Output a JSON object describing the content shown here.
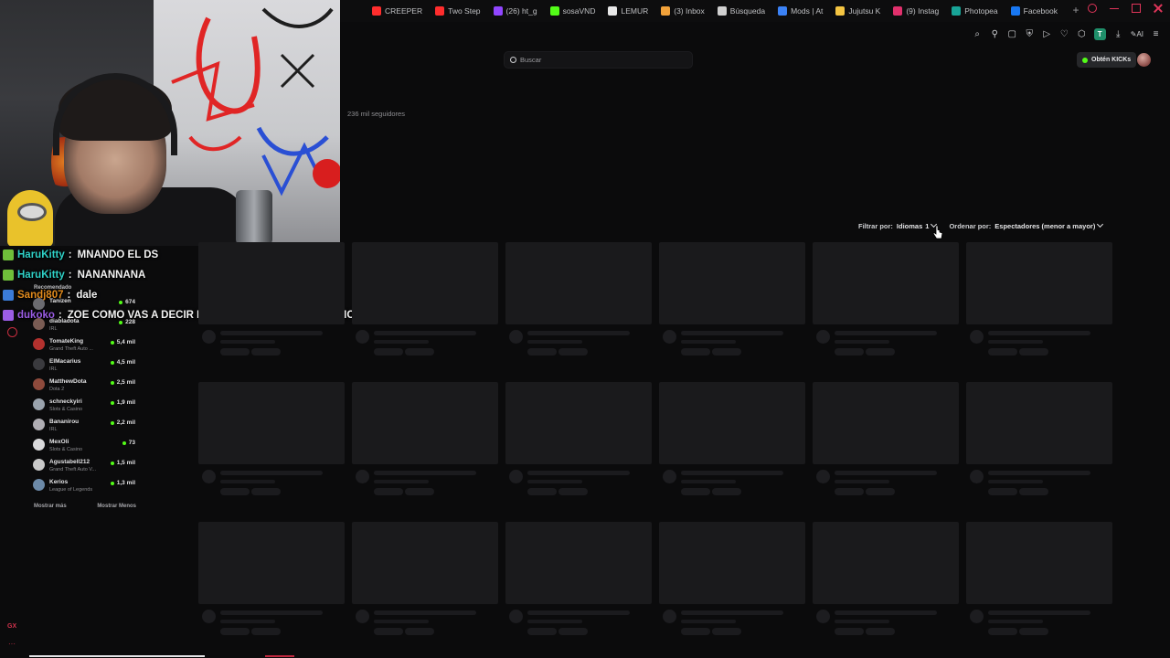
{
  "browser": {
    "tabs": [
      {
        "label": "CREEPER",
        "color": "#ff2d2d"
      },
      {
        "label": "Two Step",
        "color": "#ff2d2d"
      },
      {
        "label": "(26) ht_g",
        "color": "#9146ff"
      },
      {
        "label": "sosaVND",
        "color": "#53fc18"
      },
      {
        "label": "LEMUR",
        "color": "#e8e8e8"
      },
      {
        "label": "(3) Inbox",
        "color": "#f2a23a"
      },
      {
        "label": "Búsqueda",
        "color": "#d0d0d0"
      },
      {
        "label": "Mods | At",
        "color": "#3b82f6"
      },
      {
        "label": "Jujutsu K",
        "color": "#f5c542"
      },
      {
        "label": "(9) Instag",
        "color": "#e1306c"
      },
      {
        "label": "Photopea",
        "color": "#18a497"
      },
      {
        "label": "Facebook",
        "color": "#1877f2"
      }
    ],
    "new_tab": "+"
  },
  "toolbar": {
    "search_placeholder": "Buscar",
    "kicks_label": "Obtén KICKs",
    "ext_t": "T",
    "ext_ai": "AI"
  },
  "chat": [
    {
      "user": "HaruKitty",
      "user_color": "#2fd1c7",
      "message": "MNANDO EL DS",
      "badge_color": "#6fbf3a"
    },
    {
      "user": "HaruKitty",
      "user_color": "#2fd1c7",
      "message": "NANANNANA",
      "badge_color": "#6fbf3a"
    },
    {
      "user": "Sandj807",
      "user_color": "#e08a1d",
      "message": "dale",
      "badge_color": "#3b7bd8"
    },
    {
      "user": "dukoko",
      "user_color": "#9b5de5",
      "message": "ZOE COMO VAS A DECIR ESO LPMMM AJAJAJA TE AMO",
      "badge_color": "#9b5de5"
    }
  ],
  "sidebar": {
    "section_label": "Recomendado",
    "channels": [
      {
        "name": "Tanizen",
        "category": "",
        "viewers": "674",
        "avatar": "#6b6b70"
      },
      {
        "name": "diabladota",
        "category": "IRL",
        "viewers": "228",
        "avatar": "#7a5c54"
      },
      {
        "name": "TomateKing",
        "category": "Grand Theft Auto ...",
        "viewers": "5,4 mil",
        "avatar": "#b3312e"
      },
      {
        "name": "ElMacarius",
        "category": "IRL",
        "viewers": "4,5 mil",
        "avatar": "#3a3a3e"
      },
      {
        "name": "MatthewDota",
        "category": "Dota 2",
        "viewers": "2,5 mil",
        "avatar": "#8e4a3c"
      },
      {
        "name": "schneckyiri",
        "category": "Slots & Casino",
        "viewers": "1,9 mil",
        "avatar": "#9aa3ad"
      },
      {
        "name": "Bananirou",
        "category": "IRL",
        "viewers": "2,2 mil",
        "avatar": "#b0aeb4"
      },
      {
        "name": "MexOli",
        "category": "Slots & Casino",
        "viewers": "73",
        "avatar": "#d9d9db"
      },
      {
        "name": "Agustabell212",
        "category": "Grand Theft Auto V...",
        "viewers": "1,5 mil",
        "avatar": "#c9c9c9"
      },
      {
        "name": "Kerios",
        "category": "League of Legends",
        "viewers": "1,3 mil",
        "avatar": "#6c8aa8"
      }
    ],
    "show_more": "Mostrar más",
    "show_less": "Mostrar Menos"
  },
  "channel": {
    "followers": "236 mil seguidores"
  },
  "filters": {
    "filter_label": "Filtrar por:",
    "language_label": "Idiomas",
    "language_count": "1",
    "sort_label": "Ordenar por:",
    "sort_value": "Espectadores (menor a mayor)"
  },
  "footer": {
    "gx_label": "GX",
    "more": "···"
  }
}
